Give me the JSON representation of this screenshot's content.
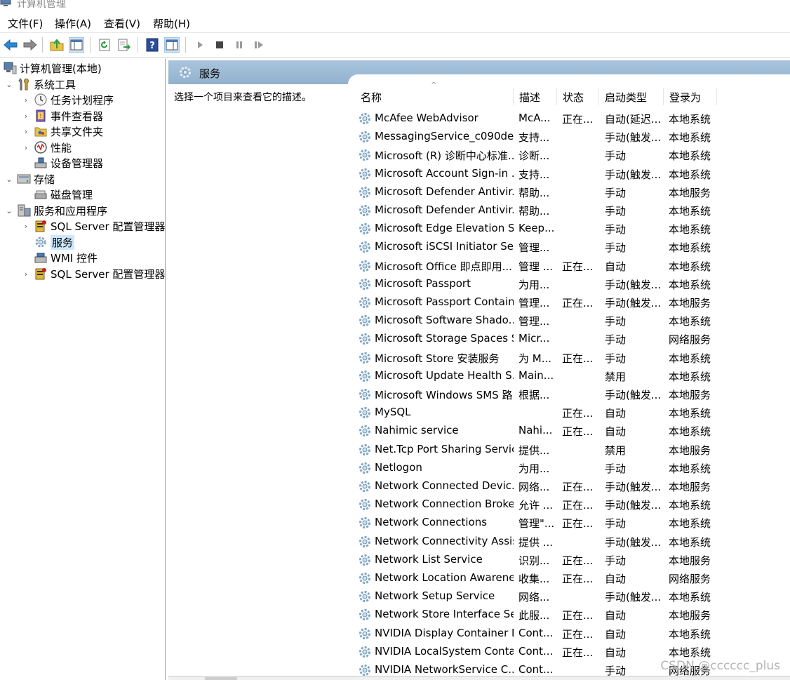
{
  "window": {
    "title": "计算机管理"
  },
  "menu": [
    "文件(F)",
    "操作(A)",
    "查看(V)",
    "帮助(H)"
  ],
  "toolbar": {
    "icons": [
      "back-arrow-icon",
      "forward-arrow-icon",
      "up-folder-icon",
      "show-hide-tree-icon",
      "refresh-icon",
      "export-list-icon",
      "help-icon",
      "properties-icon",
      "play-icon",
      "stop-icon",
      "pause-icon",
      "resume-icon"
    ]
  },
  "tree": {
    "root": "计算机管理(本地)",
    "system_tools": "系统工具",
    "task_scheduler": "任务计划程序",
    "event_viewer": "事件查看器",
    "shared_folders": "共享文件夹",
    "performance": "性能",
    "device_manager": "设备管理器",
    "storage": "存储",
    "disk_management": "磁盘管理",
    "services_apps": "服务和应用程序",
    "sql_config_1": "SQL Server 配置管理器",
    "services": "服务",
    "wmi": "WMI 控件",
    "sql_config_2": "SQL Server 配置管理器"
  },
  "pane": {
    "title": "服务",
    "description_prompt": "选择一个项目来查看它的描述。"
  },
  "columns": {
    "name": "名称",
    "desc": "描述",
    "status": "状态",
    "startup": "启动类型",
    "logon": "登录为"
  },
  "services": [
    {
      "name": "McAfee WebAdvisor",
      "desc": "McA...",
      "status": "正在...",
      "startup": "自动(延迟...",
      "logon": "本地系统"
    },
    {
      "name": "MessagingService_c090de...",
      "desc": "支持...",
      "status": "",
      "startup": "手动(触发...",
      "logon": "本地系统"
    },
    {
      "name": "Microsoft (R) 诊断中心标准...",
      "desc": "诊断...",
      "status": "",
      "startup": "手动",
      "logon": "本地系统"
    },
    {
      "name": "Microsoft Account Sign-in ...",
      "desc": "支持...",
      "status": "",
      "startup": "手动(触发...",
      "logon": "本地系统"
    },
    {
      "name": "Microsoft Defender Antivir...",
      "desc": "帮助...",
      "status": "",
      "startup": "手动",
      "logon": "本地服务"
    },
    {
      "name": "Microsoft Defender Antivir...",
      "desc": "帮助...",
      "status": "",
      "startup": "手动",
      "logon": "本地系统"
    },
    {
      "name": "Microsoft Edge Elevation S...",
      "desc": "Keep...",
      "status": "",
      "startup": "手动",
      "logon": "本地系统"
    },
    {
      "name": "Microsoft iSCSI Initiator Ser...",
      "desc": "管理...",
      "status": "",
      "startup": "手动",
      "logon": "本地系统"
    },
    {
      "name": "Microsoft Office 即点即用...",
      "desc": "管理 ...",
      "status": "正在...",
      "startup": "自动",
      "logon": "本地系统"
    },
    {
      "name": "Microsoft Passport",
      "desc": "为用...",
      "status": "",
      "startup": "手动(触发...",
      "logon": "本地系统"
    },
    {
      "name": "Microsoft Passport Container",
      "desc": "管理...",
      "status": "正在...",
      "startup": "手动(触发...",
      "logon": "本地服务"
    },
    {
      "name": "Microsoft Software Shado...",
      "desc": "管理...",
      "status": "",
      "startup": "手动",
      "logon": "本地系统"
    },
    {
      "name": "Microsoft Storage Spaces S...",
      "desc": "Micr...",
      "status": "",
      "startup": "手动",
      "logon": "网络服务"
    },
    {
      "name": "Microsoft Store 安装服务",
      "desc": "为 M...",
      "status": "正在...",
      "startup": "手动",
      "logon": "本地系统"
    },
    {
      "name": "Microsoft Update Health S...",
      "desc": "Main...",
      "status": "",
      "startup": "禁用",
      "logon": "本地系统"
    },
    {
      "name": "Microsoft Windows SMS 路...",
      "desc": "根据...",
      "status": "",
      "startup": "手动(触发...",
      "logon": "本地服务"
    },
    {
      "name": "MySQL",
      "desc": "",
      "status": "正在...",
      "startup": "自动",
      "logon": "本地系统"
    },
    {
      "name": "Nahimic service",
      "desc": "Nahi...",
      "status": "正在...",
      "startup": "自动",
      "logon": "本地系统"
    },
    {
      "name": "Net.Tcp Port Sharing Service",
      "desc": "提供...",
      "status": "",
      "startup": "禁用",
      "logon": "本地服务"
    },
    {
      "name": "Netlogon",
      "desc": "为用...",
      "status": "",
      "startup": "手动",
      "logon": "本地系统"
    },
    {
      "name": "Network Connected Devic...",
      "desc": "网络...",
      "status": "正在...",
      "startup": "手动(触发...",
      "logon": "本地服务"
    },
    {
      "name": "Network Connection Broker",
      "desc": "允许 ...",
      "status": "正在...",
      "startup": "手动(触发...",
      "logon": "本地系统"
    },
    {
      "name": "Network Connections",
      "desc": "管理\"...",
      "status": "正在...",
      "startup": "手动",
      "logon": "本地系统"
    },
    {
      "name": "Network Connectivity Assis...",
      "desc": "提供 ...",
      "status": "",
      "startup": "手动(触发...",
      "logon": "本地系统"
    },
    {
      "name": "Network List Service",
      "desc": "识别...",
      "status": "正在...",
      "startup": "手动",
      "logon": "本地服务"
    },
    {
      "name": "Network Location Awarene...",
      "desc": "收集...",
      "status": "正在...",
      "startup": "自动",
      "logon": "网络服务"
    },
    {
      "name": "Network Setup Service",
      "desc": "网络...",
      "status": "",
      "startup": "手动(触发...",
      "logon": "本地系统"
    },
    {
      "name": "Network Store Interface Se...",
      "desc": "此服...",
      "status": "正在...",
      "startup": "自动",
      "logon": "本地服务"
    },
    {
      "name": "NVIDIA Display Container LS",
      "desc": "Cont...",
      "status": "正在...",
      "startup": "自动",
      "logon": "本地系统"
    },
    {
      "name": "NVIDIA LocalSystem Conta...",
      "desc": "Cont...",
      "status": "正在...",
      "startup": "自动",
      "logon": "本地系统"
    },
    {
      "name": "NVIDIA NetworkService C...",
      "desc": "Cont...",
      "status": "",
      "startup": "手动",
      "logon": "网络服务"
    }
  ],
  "watermark": "CSDN @cccccc_plus",
  "colors": {
    "header_blue": "#9db9d4",
    "selection": "#cce8ff",
    "gear": "#7fa6c4"
  }
}
